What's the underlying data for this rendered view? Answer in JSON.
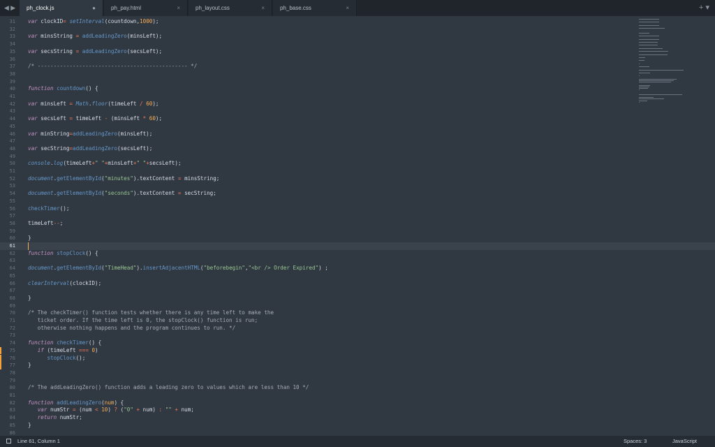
{
  "tabs": [
    {
      "label": "ph_clock.js",
      "active": true,
      "close": "●"
    },
    {
      "label": "ph_pay.html",
      "active": false,
      "close": "×"
    },
    {
      "label": "ph_layout.css",
      "active": false,
      "close": "×"
    },
    {
      "label": "ph_base.css",
      "active": false,
      "close": "×"
    }
  ],
  "tab_nav": "◀ ▶",
  "tab_actions": "+ ▾",
  "colors": {
    "background": "#303841",
    "tabbar": "#1f252b",
    "keyword": "#c594c5",
    "function": "#6699cc",
    "operator": "#f97b58",
    "number": "#f9ae58",
    "string": "#99c794",
    "comment": "#a6acb9",
    "modified_marker": "#f5a23b"
  },
  "editor": {
    "first_line": 31,
    "current_line": 61,
    "lines": [
      [
        [
          "var",
          "k"
        ],
        [
          " clockID",
          ""
        ],
        [
          "=",
          "o"
        ],
        [
          " ",
          ""
        ],
        [
          "setInterval",
          "fi"
        ],
        [
          "(countdown,",
          ""
        ],
        [
          "1000",
          "n"
        ],
        [
          ");",
          ""
        ]
      ],
      [],
      [
        [
          "var",
          "k"
        ],
        [
          " minsString ",
          ""
        ],
        [
          "=",
          "o"
        ],
        [
          " ",
          ""
        ],
        [
          "addLeadingZero",
          "f"
        ],
        [
          "(minsLeft);",
          ""
        ]
      ],
      [],
      [
        [
          "var",
          "k"
        ],
        [
          " secsString ",
          ""
        ],
        [
          "=",
          "o"
        ],
        [
          " ",
          ""
        ],
        [
          "addLeadingZero",
          "f"
        ],
        [
          "(secsLeft);",
          ""
        ]
      ],
      [],
      [
        [
          "/* ----------------------------------------------- */",
          "c"
        ]
      ],
      [],
      [],
      [
        [
          "function",
          "k"
        ],
        [
          " ",
          ""
        ],
        [
          "countdown",
          "f"
        ],
        [
          "() {",
          ""
        ]
      ],
      [],
      [
        [
          "var",
          "k"
        ],
        [
          " minsLeft ",
          ""
        ],
        [
          "=",
          "o"
        ],
        [
          " ",
          ""
        ],
        [
          "Math",
          "fi"
        ],
        [
          ".",
          ""
        ],
        [
          "floor",
          "fi"
        ],
        [
          "(timeLeft ",
          ""
        ],
        [
          "/",
          "o"
        ],
        [
          " ",
          ""
        ],
        [
          "60",
          "n"
        ],
        [
          ");",
          ""
        ]
      ],
      [],
      [
        [
          "var",
          "k"
        ],
        [
          " secsLeft ",
          ""
        ],
        [
          "=",
          "o"
        ],
        [
          " timeLeft ",
          ""
        ],
        [
          "-",
          "o"
        ],
        [
          " (minsLeft ",
          ""
        ],
        [
          "*",
          "o"
        ],
        [
          " ",
          ""
        ],
        [
          "60",
          "n"
        ],
        [
          ");",
          ""
        ]
      ],
      [],
      [
        [
          "var",
          "k"
        ],
        [
          " minString",
          ""
        ],
        [
          "=",
          "o"
        ],
        [
          "addLeadingZero",
          "f"
        ],
        [
          "(minsLeft);",
          ""
        ]
      ],
      [],
      [
        [
          "var",
          "k"
        ],
        [
          " secString",
          ""
        ],
        [
          "=",
          "o"
        ],
        [
          "addLeadingZero",
          "f"
        ],
        [
          "(secsLeft);",
          ""
        ]
      ],
      [],
      [
        [
          "console",
          "fi"
        ],
        [
          ".",
          ""
        ],
        [
          "log",
          "fi"
        ],
        [
          "(timeLeft",
          ""
        ],
        [
          "+",
          "o"
        ],
        [
          "\" \"",
          "s"
        ],
        [
          "+",
          "o"
        ],
        [
          "minsLeft",
          ""
        ],
        [
          "+",
          "o"
        ],
        [
          "\" \"",
          "s"
        ],
        [
          "+",
          "o"
        ],
        [
          "secsLeft);",
          ""
        ]
      ],
      [],
      [
        [
          "document",
          "fi"
        ],
        [
          ".",
          ""
        ],
        [
          "getElementById",
          "f"
        ],
        [
          "(",
          ""
        ],
        [
          "\"minutes\"",
          "s"
        ],
        [
          ").textContent ",
          ""
        ],
        [
          "=",
          "o"
        ],
        [
          " minsString;",
          ""
        ]
      ],
      [],
      [
        [
          "document",
          "fi"
        ],
        [
          ".",
          ""
        ],
        [
          "getElementById",
          "f"
        ],
        [
          "(",
          ""
        ],
        [
          "\"seconds\"",
          "s"
        ],
        [
          ").textContent ",
          ""
        ],
        [
          "=",
          "o"
        ],
        [
          " secString;",
          ""
        ]
      ],
      [],
      [
        [
          "checkTimer",
          "f"
        ],
        [
          "();",
          ""
        ]
      ],
      [],
      [
        [
          "timeLeft",
          ""
        ],
        [
          "--",
          "o"
        ],
        [
          ";",
          ""
        ]
      ],
      [],
      [
        [
          "}",
          ""
        ]
      ],
      [],
      [
        [
          "function",
          "k"
        ],
        [
          " ",
          ""
        ],
        [
          "stopClock",
          "f"
        ],
        [
          "() {",
          ""
        ]
      ],
      [],
      [
        [
          "document",
          "fi"
        ],
        [
          ".",
          ""
        ],
        [
          "getElementById",
          "f"
        ],
        [
          "(",
          ""
        ],
        [
          "\"TimeHead\"",
          "s"
        ],
        [
          ").",
          ""
        ],
        [
          "insertAdjacentHTML",
          "f"
        ],
        [
          "(",
          ""
        ],
        [
          "\"beforebegin\"",
          "s"
        ],
        [
          ",",
          ""
        ],
        [
          "\"<br /> Order Expired\"",
          "s"
        ],
        [
          ") ;",
          ""
        ]
      ],
      [],
      [
        [
          "clearInterval",
          "fi"
        ],
        [
          "(clockID);",
          ""
        ]
      ],
      [],
      [
        [
          "}",
          ""
        ]
      ],
      [],
      [
        [
          "/* The checkTimer() function tests whether there is any time left to make the",
          "c"
        ]
      ],
      [
        [
          "   ticket order. If the time left is 0, the stopClock() function is run;",
          "c"
        ]
      ],
      [
        [
          "   otherwise nothing happens and the program continues to run. */",
          "c"
        ]
      ],
      [],
      [
        [
          "function",
          "k"
        ],
        [
          " ",
          ""
        ],
        [
          "checkTimer",
          "f"
        ],
        [
          "() {",
          ""
        ]
      ],
      [
        [
          "   ",
          ""
        ],
        [
          "if",
          "k"
        ],
        [
          " (timeLeft ",
          ""
        ],
        [
          "===",
          "o"
        ],
        [
          " ",
          ""
        ],
        [
          "0",
          "n"
        ],
        [
          ")",
          ""
        ]
      ],
      [
        [
          "      ",
          ""
        ],
        [
          "stopClock",
          "f"
        ],
        [
          "();",
          ""
        ]
      ],
      [
        [
          "}",
          ""
        ]
      ],
      [],
      [],
      [
        [
          "/* The addLeadingZero() function adds a leading zero to values which are less than 10 */",
          "c"
        ]
      ],
      [],
      [
        [
          "function",
          "k"
        ],
        [
          " ",
          ""
        ],
        [
          "addLeadingZero",
          "f"
        ],
        [
          "(",
          ""
        ],
        [
          "num",
          "n"
        ],
        [
          ") {",
          ""
        ]
      ],
      [
        [
          "   ",
          ""
        ],
        [
          "var",
          "k"
        ],
        [
          " numStr ",
          ""
        ],
        [
          "=",
          "o"
        ],
        [
          " (num ",
          ""
        ],
        [
          "<",
          "o"
        ],
        [
          " ",
          ""
        ],
        [
          "10",
          "n"
        ],
        [
          ") ",
          ""
        ],
        [
          "?",
          "o"
        ],
        [
          " (",
          ""
        ],
        [
          "\"0\"",
          "s"
        ],
        [
          " ",
          ""
        ],
        [
          "+",
          "o"
        ],
        [
          " num) ",
          ""
        ],
        [
          ":",
          "o"
        ],
        [
          " ",
          ""
        ],
        [
          "\"\"",
          "s"
        ],
        [
          " ",
          ""
        ],
        [
          "+",
          "o"
        ],
        [
          " num;",
          ""
        ]
      ],
      [
        [
          "   ",
          ""
        ],
        [
          "return",
          "k"
        ],
        [
          " numStr;",
          ""
        ]
      ],
      [
        [
          "}",
          ""
        ]
      ],
      []
    ],
    "line_numbers": [
      "31",
      "32",
      "33",
      "34",
      "35",
      "36",
      "37",
      "38",
      "39",
      "40",
      "41",
      "42",
      "43",
      "44",
      "45",
      "46",
      "47",
      "48",
      "49",
      "50",
      "51",
      "52",
      "53",
      "54",
      "55",
      "56",
      "57",
      "58",
      "59",
      "60",
      "61",
      "62",
      "63",
      "64",
      "65",
      "66",
      "67",
      "68",
      "69",
      "70",
      "71",
      "72",
      "73",
      "74",
      "75",
      "76",
      "77",
      "78",
      "79",
      "80",
      "81",
      "82",
      "83",
      "84",
      "85",
      "86"
    ]
  },
  "status": {
    "position": "Line 61, Column 1",
    "spaces": "Spaces: 3",
    "syntax": "JavaScript"
  }
}
